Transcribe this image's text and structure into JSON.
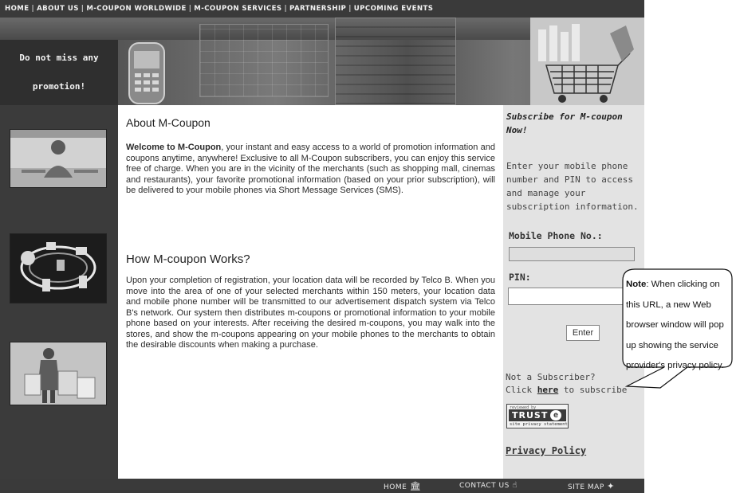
{
  "nav": {
    "items": [
      "HOME",
      "ABOUT US",
      "M-COUPON WORLDWIDE",
      "M-COUPON SERVICES",
      "PARTNERSHIP",
      "UPCOMING EVENTS"
    ],
    "separator": "|"
  },
  "banner": {
    "tagline_line1": "Do not miss any",
    "tagline_line2": "promotion!"
  },
  "main": {
    "about_title": "About M-Coupon",
    "welcome_bold": "Welcome to M-Coupon",
    "welcome_text": ", your instant and easy access to a world of promotion information and coupons anytime, anywhere! Exclusive to all M-Coupon subscribers, you can enjoy this service free of charge. When you are in the vicinity of the merchants (such as shopping mall, cinemas and restaurants), your favorite promotional information (based on your prior subscription), will be delivered to your mobile phones via Short Message Services (SMS).",
    "how_title": "How M-coupon Works?",
    "how_text": "Upon your completion of registration, your location data will be recorded by Telco B. When you move into the area of one of your selected merchants within 150 meters, your location data and mobile phone number will be transmitted to our advertisement dispatch system via Telco B's network. Our system then distributes m-coupons or promotional information to your mobile phone based on your interests. After receiving the desired m-coupons, you may walk into the stores, and show the m-coupons appearing on your mobile phones to the merchants to obtain the desirable discounts when making a purchase."
  },
  "subscribe": {
    "title": "Subscribe for M-coupon Now!",
    "intro": "Enter your mobile phone number and PIN to access and manage your subscription information.",
    "phone_label": "Mobile Phone No.:",
    "phone_value": "",
    "pin_label": "PIN:",
    "pin_value": "",
    "enter_label": "Enter",
    "not_subscriber": "Not a Subscriber?",
    "click_prefix": "Click ",
    "here_link": "here",
    "click_suffix": " to subscribe",
    "trust_small": "reviewed by",
    "trust_brand": "TRUST",
    "trust_sub": "site privacy statement",
    "privacy_link": "Privacy Policy"
  },
  "footer": {
    "home": "HOME",
    "contact": "CONTACT US",
    "sitemap": "SITE MAP"
  },
  "callout": {
    "note_bold": "Note",
    "note_text": ": When clicking on this URL, a new Web browser window will pop up showing the service provider's privacy policy."
  },
  "colors": {
    "dark_bar": "#3a3a3a",
    "side_column": "#3b3b3b",
    "right_panel": "#e3e3e3",
    "content_bg": "#ffffff"
  }
}
